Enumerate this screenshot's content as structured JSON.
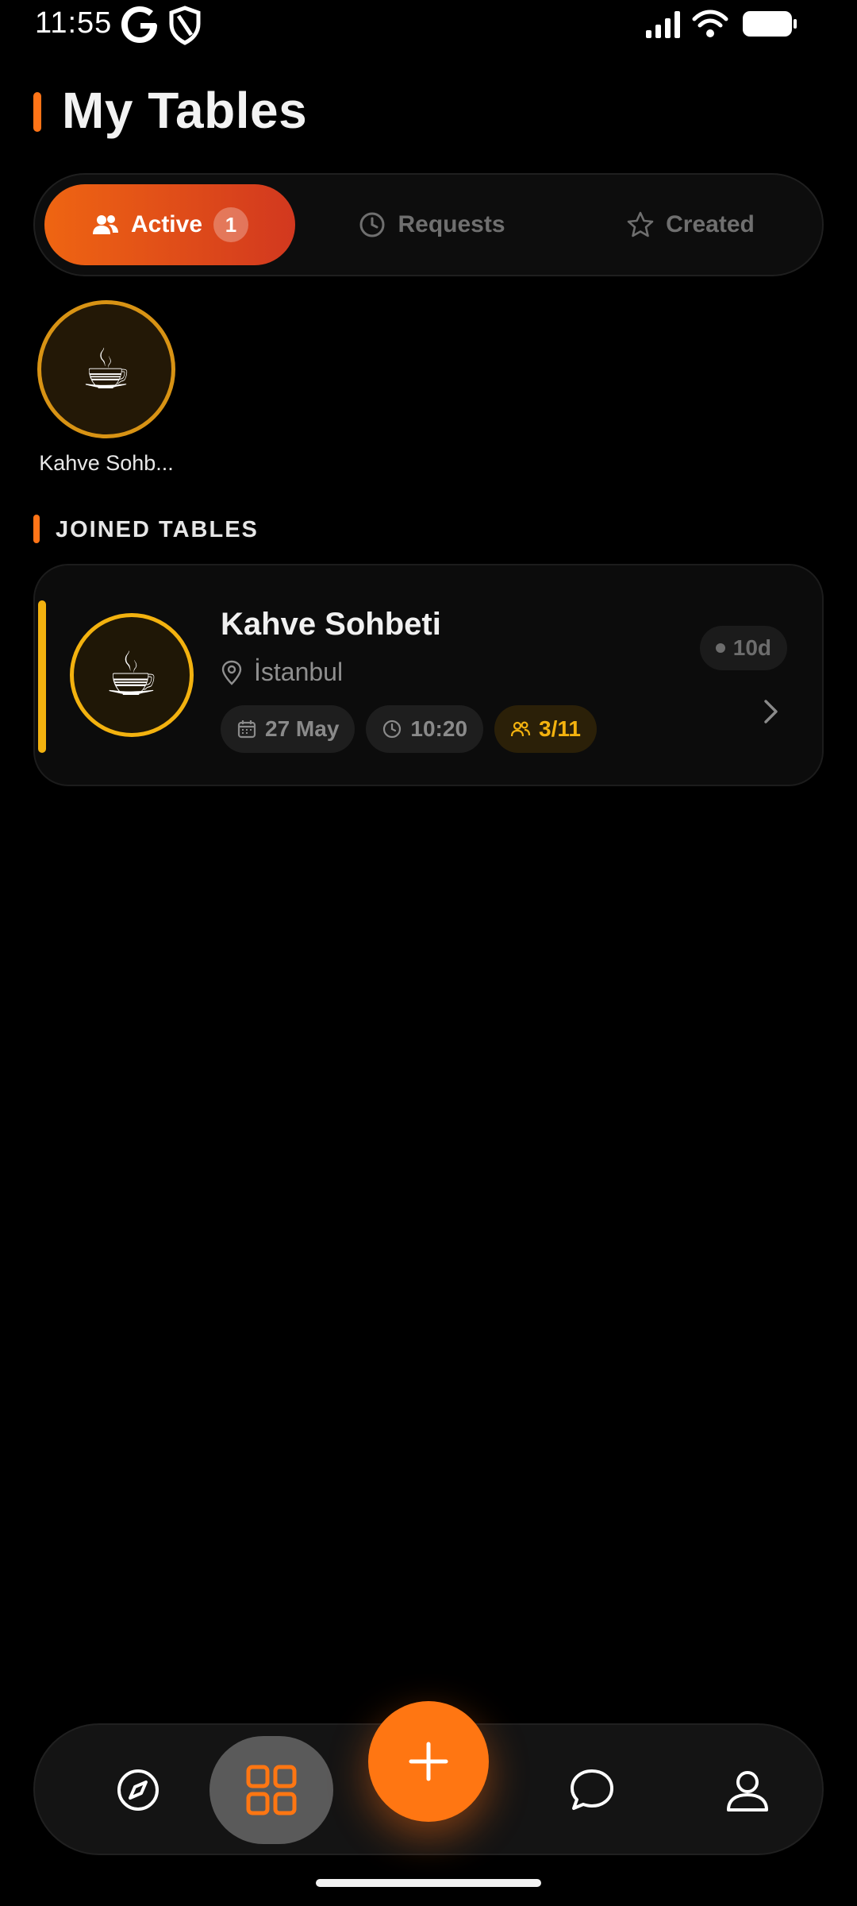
{
  "status_bar": {
    "time": "11:55"
  },
  "header": {
    "title": "My Tables",
    "accent_color": "#ff7417"
  },
  "tabs": [
    {
      "label": "Active",
      "badge": "1",
      "selected": true,
      "icon": "users-icon"
    },
    {
      "label": "Requests",
      "selected": false,
      "icon": "clock-icon"
    },
    {
      "label": "Created",
      "selected": false,
      "icon": "star-icon"
    }
  ],
  "stories": [
    {
      "emoji": "☕",
      "label": "Kahve Sohb..."
    }
  ],
  "section": {
    "title": "JOINED TABLES"
  },
  "tables": [
    {
      "emoji": "☕",
      "title": "Kahve Sohbeti",
      "location": "İstanbul",
      "date": "27 May",
      "time": "10:20",
      "members": "3/11",
      "time_left": "10d",
      "accent_color": "#f3b20f"
    }
  ],
  "bottom_nav": {
    "items": [
      "compass-icon",
      "grid-icon",
      "plus-icon",
      "chat-icon",
      "profile-icon"
    ],
    "selected": "grid-icon",
    "fab_color": "#ff7612"
  }
}
